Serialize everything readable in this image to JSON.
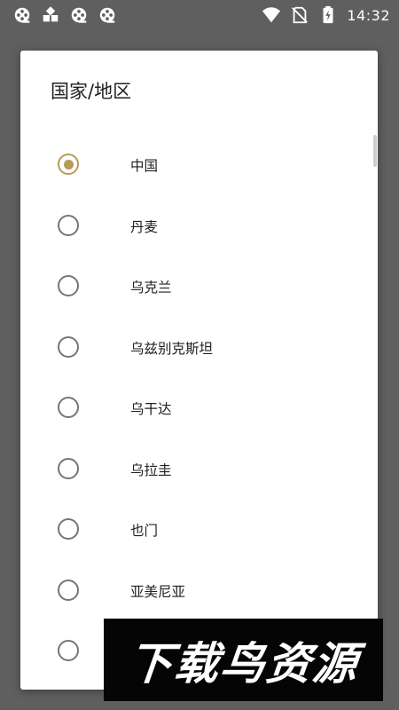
{
  "status_bar": {
    "time": "14:32",
    "left_icons": [
      "app-notification-icon",
      "app-notification-icon",
      "app-notification-icon",
      "app-notification-icon"
    ],
    "right_icons": [
      "wifi-icon",
      "no-sim-icon",
      "battery-charging-icon"
    ],
    "icon_color": "#ffffff"
  },
  "dialog": {
    "title": "国家/地区",
    "accent_color": "#b69a5a",
    "options": [
      {
        "label": "中国",
        "selected": true
      },
      {
        "label": "丹麦",
        "selected": false
      },
      {
        "label": "乌克兰",
        "selected": false
      },
      {
        "label": "乌兹别克斯坦",
        "selected": false
      },
      {
        "label": "乌干达",
        "selected": false
      },
      {
        "label": "乌拉圭",
        "selected": false
      },
      {
        "label": "也门",
        "selected": false
      },
      {
        "label": "亚美尼亚",
        "selected": false
      },
      {
        "label": "",
        "selected": false
      }
    ]
  },
  "watermark": {
    "text": "下载鸟资源"
  }
}
